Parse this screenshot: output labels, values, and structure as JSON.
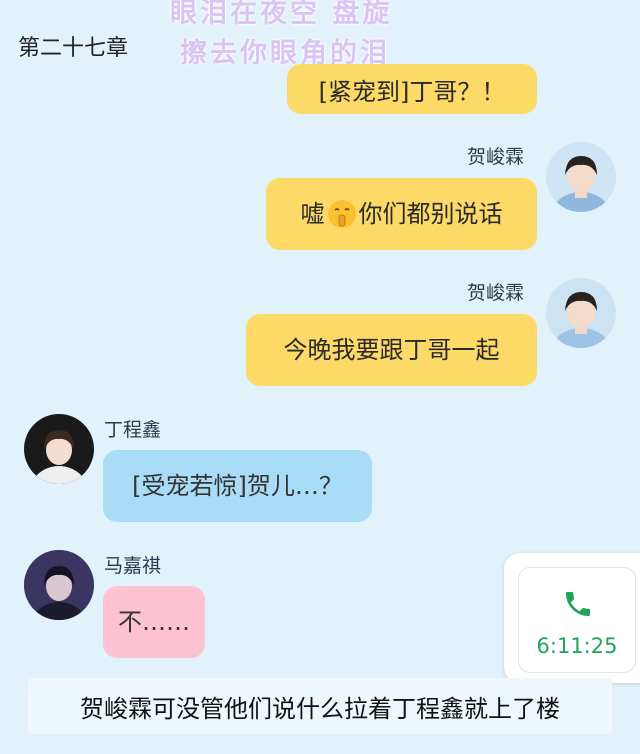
{
  "header": {
    "title": "第二十七章"
  },
  "watermark": {
    "line1": "眼泪在夜空 盘旋",
    "line2": "擦去你眼角的泪"
  },
  "messages": [
    {
      "sender": "",
      "text": "[紧宠到]丁哥？！",
      "side": "right"
    },
    {
      "sender": "贺峻霖",
      "text_before": "嘘",
      "emoji": "🤫",
      "text_after": "你们都别说话",
      "side": "right"
    },
    {
      "sender": "贺峻霖",
      "text": "今晚我要跟丁哥一起",
      "side": "right"
    },
    {
      "sender": "丁程鑫",
      "text": "[受宠若惊]贺儿…？",
      "side": "left"
    },
    {
      "sender": "马嘉祺",
      "text": "不……",
      "side": "left"
    }
  ],
  "call": {
    "duration": "6:11:25",
    "icon": "phone-icon",
    "color": "#22a35a"
  },
  "narration": "贺峻霖可没管他们说什么拉着丁程鑫就上了楼",
  "colors": {
    "background": "#e2f2fb",
    "yellow_bubble": "#fdd968",
    "blue_bubble": "#a8dcf7",
    "pink_bubble": "#fdc3d2"
  }
}
